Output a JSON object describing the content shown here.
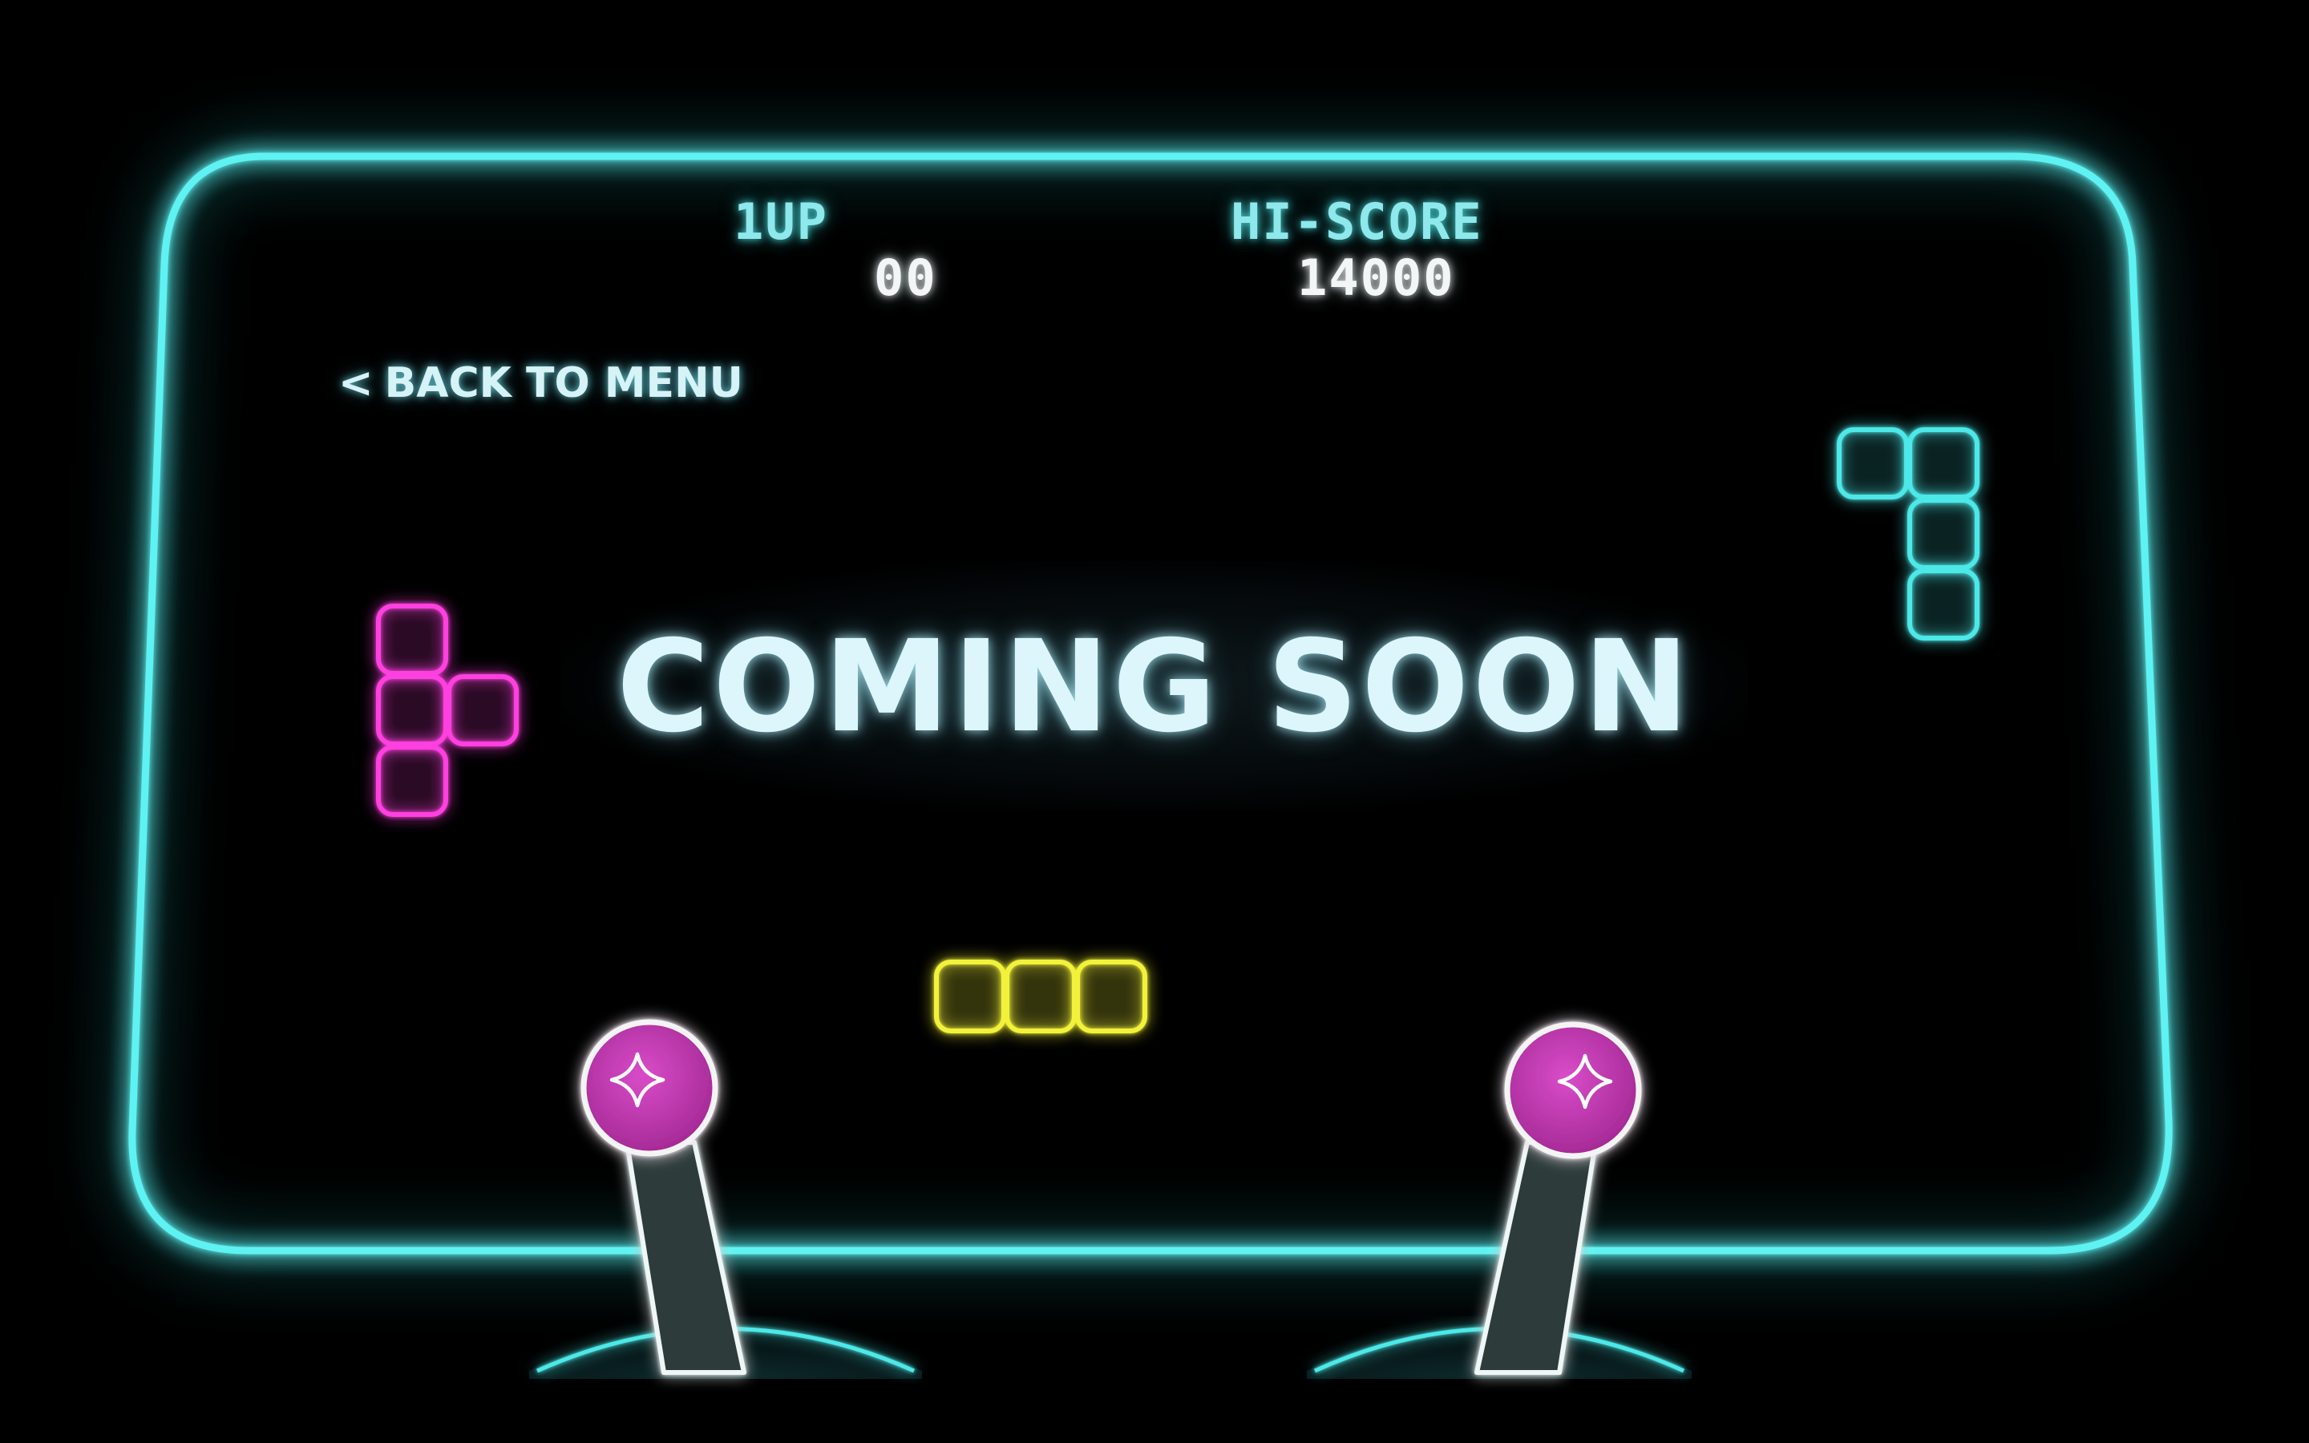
{
  "hud": {
    "player_label": "1UP",
    "player_score": "00",
    "hiscore_label": "HI-SCORE",
    "hiscore_value": "14000"
  },
  "nav": {
    "back_arrow": "<",
    "back_label": "BACK TO MENU"
  },
  "main": {
    "title": "COMING SOON"
  },
  "colors": {
    "background": "#000000",
    "frame_cyan": "#5ff2f2",
    "piece_magenta": "#ff3fe0",
    "piece_cyan": "#4de8e8",
    "piece_yellow": "#f2f23a",
    "knob_pink": "#c63ab6",
    "text_light": "#dcf6fb"
  },
  "icons": [
    "sparkle-icon",
    "joystick-knob",
    "tetromino-t",
    "tetromino-j",
    "tetromino-i"
  ]
}
